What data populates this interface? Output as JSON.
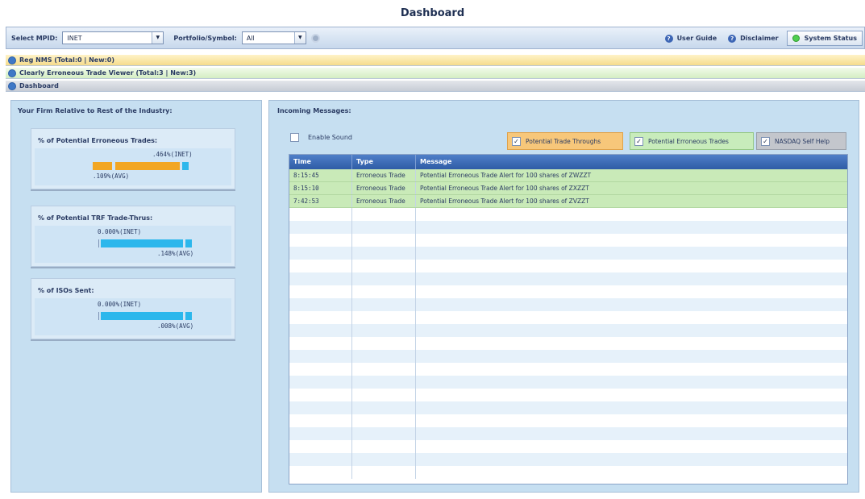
{
  "title": "Dashboard",
  "toolbar": {
    "mpid_label": "Select MPID:",
    "mpid_value": "INET",
    "symbol_label": "Portfolio/Symbol:",
    "symbol_value": "All",
    "user_guide": "User Guide",
    "disclaimer": "Disclaimer",
    "system_status": "System Status"
  },
  "strips": {
    "reg_nms": "Reg NMS (Total:0 | New:0)",
    "cetv": "Clearly Erroneous Trade Viewer (Total:3 | New:3)",
    "dashboard": "Dashboard"
  },
  "left": {
    "title": "Your Firm Relative to Rest of the Industry:",
    "cards": [
      {
        "title": "% of Potential Erroneous Trades:",
        "firm_label": ".464%(INET)",
        "avg_label": ".109%(AVG)",
        "firm_value": 0.464,
        "avg_value": 0.109
      },
      {
        "title": "% of Potential TRF Trade-Thrus:",
        "firm_label": "0.000%(INET)",
        "avg_label": ".148%(AVG)",
        "firm_value": 0.0,
        "avg_value": 0.148
      },
      {
        "title": "% of ISOs Sent:",
        "firm_label": "0.000%(INET)",
        "avg_label": ".008%(AVG)",
        "firm_value": 0.0,
        "avg_value": 0.008
      }
    ]
  },
  "right": {
    "title": "Incoming Messages:",
    "enable_sound": "Enable Sound",
    "filters": [
      "Potential Trade Throughs",
      "Potential Erroneous Trades",
      "NASDAQ Self Help"
    ],
    "columns": [
      "Time",
      "Type",
      "Message"
    ],
    "rows": [
      {
        "time": "8:15:45",
        "type": "Erroneous Trade",
        "message": "Potential Erroneous Trade Alert for 100 shares of ZWZZT"
      },
      {
        "time": "8:15:10",
        "type": "Erroneous Trade",
        "message": "Potential Erroneous Trade Alert for 100 shares of ZXZZT"
      },
      {
        "time": "7:42:53",
        "type": "Erroneous Trade",
        "message": "Potential Erroneous Trade Alert for 100 shares of ZVZZT"
      }
    ]
  },
  "colors": {
    "orange_bar": "#f2a623",
    "blue_bar": "#2cb7ec",
    "message_row": "#c9eab8",
    "header": "#2f5ca6"
  }
}
